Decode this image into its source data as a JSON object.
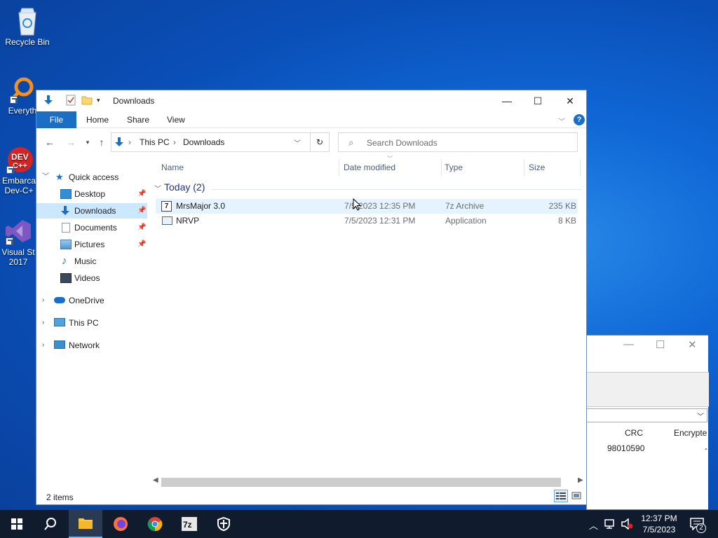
{
  "desktop": {
    "icons": [
      {
        "label": "Recycle Bin"
      },
      {
        "label": "Everyth"
      },
      {
        "label": "Embarca Dev-C+"
      },
      {
        "label": "Visual St 2017"
      }
    ]
  },
  "explorer": {
    "title": "Downloads",
    "controls": {
      "minimize": "—",
      "maximize": "☐",
      "close": "✕"
    },
    "ribbon": {
      "file": "File",
      "home": "Home",
      "share": "Share",
      "view": "View"
    },
    "address": {
      "crumb1": "This PC",
      "crumb2": "Downloads"
    },
    "search_placeholder": "Search Downloads",
    "nav": {
      "quick_access": "Quick access",
      "desktop": "Desktop",
      "downloads": "Downloads",
      "documents": "Documents",
      "pictures": "Pictures",
      "music": "Music",
      "videos": "Videos",
      "onedrive": "OneDrive",
      "thispc": "This PC",
      "network": "Network"
    },
    "columns": {
      "name": "Name",
      "date": "Date modified",
      "type": "Type",
      "size": "Size"
    },
    "group": "Today (2)",
    "files": [
      {
        "name": "MrsMajor 3.0",
        "date": "7/5/2023 12:35 PM",
        "type": "7z Archive",
        "size": "235 KB"
      },
      {
        "name": "NRVP",
        "date": "7/5/2023 12:31 PM",
        "type": "Application",
        "size": "8 KB"
      }
    ],
    "status": "2 items"
  },
  "bg_window": {
    "columns": {
      "crc": "CRC",
      "encrypted": "Encrypte"
    },
    "row": {
      "crc": "98010590",
      "encrypted": "-"
    }
  },
  "taskbar": {
    "time": "12:37 PM",
    "date": "7/5/2023",
    "notification_count": "2"
  }
}
